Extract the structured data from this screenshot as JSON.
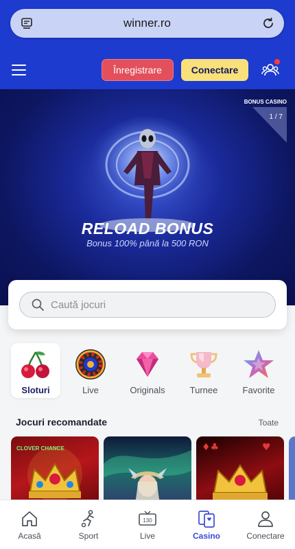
{
  "browser": {
    "url": "winner.ro"
  },
  "header": {
    "register_label": "Înregistrare",
    "login_label": "Conectare"
  },
  "banner": {
    "title": "RELOAD BONUS",
    "subtitle": "Bonus 100% până la 500 RON",
    "tag": "BONUS CASINO",
    "counter": "1 / 7"
  },
  "search": {
    "placeholder": "Caută jocuri"
  },
  "categories": [
    {
      "label": "Sloturi",
      "icon": "cherries-icon",
      "active": true
    },
    {
      "label": "Live",
      "icon": "roulette-icon"
    },
    {
      "label": "Originals",
      "icon": "diamond-icon"
    },
    {
      "label": "Turnee",
      "icon": "trophy-icon"
    },
    {
      "label": "Favorite",
      "icon": "star-icon"
    }
  ],
  "recommended": {
    "title": "Jocuri recomandate",
    "all_label": "Toate",
    "games": [
      {
        "badge": "CLOVER CHANCE"
      },
      {},
      {}
    ]
  },
  "nav": [
    {
      "label": "Acasă",
      "icon": "home-icon"
    },
    {
      "label": "Sport",
      "icon": "soccer-player-icon"
    },
    {
      "label": "Live",
      "icon": "tv-live-icon",
      "badge": "130"
    },
    {
      "label": "Casino",
      "icon": "casino-cards-icon",
      "active": true
    },
    {
      "label": "Conectare",
      "icon": "user-icon"
    }
  ],
  "colors": {
    "brand_blue": "#1d3bcf",
    "register_red": "#e34f5b",
    "login_yellow": "#f9e07a",
    "active_nav": "#3a4bd3"
  }
}
